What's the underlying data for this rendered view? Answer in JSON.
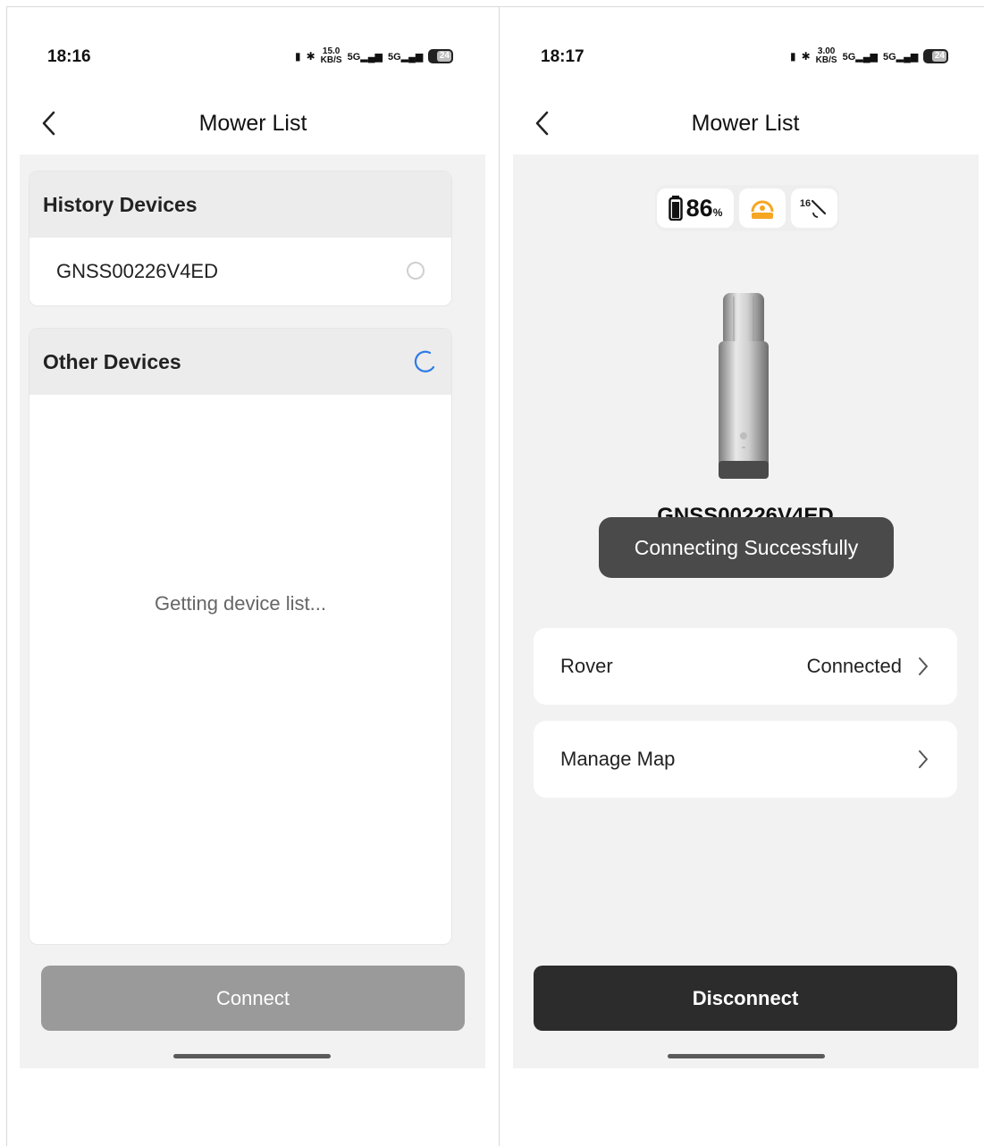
{
  "left": {
    "status": {
      "time": "18:16",
      "speed_value": "15.0",
      "speed_unit": "KB/S",
      "net1": "5G",
      "net2": "5G",
      "battery": "24"
    },
    "title": "Mower List",
    "history": {
      "heading": "History Devices",
      "devices": [
        {
          "name": "GNSS00226V4ED"
        }
      ]
    },
    "other": {
      "heading": "Other Devices",
      "status_text": "Getting device list..."
    },
    "connect_label": "Connect"
  },
  "right": {
    "status": {
      "time": "18:17",
      "speed_value": "3.00",
      "speed_unit": "KB/S",
      "net1": "5G",
      "net2": "5G",
      "battery": "24"
    },
    "title": "Mower List",
    "battery_percent": "86",
    "battery_unit": "%",
    "satellite_count": "16",
    "device_name": "GNSS00226V4ED",
    "toast": "Connecting Successfully",
    "rover": {
      "label": "Rover",
      "value": "Connected"
    },
    "manage_map": {
      "label": "Manage Map"
    },
    "disconnect_label": "Disconnect"
  },
  "colors": {
    "accent_spinner": "#2f7be8",
    "badge_orange": "#f5a623",
    "dark_button": "#2c2c2c",
    "disabled_button": "#9a9a9a"
  }
}
